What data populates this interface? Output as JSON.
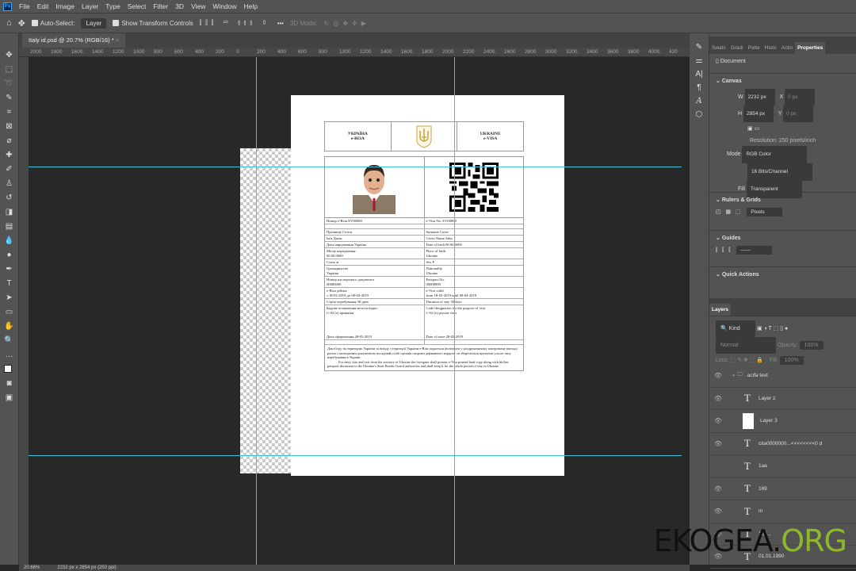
{
  "app": {
    "logo": "Ps",
    "menu": [
      "File",
      "Edit",
      "Image",
      "Layer",
      "Type",
      "Select",
      "Filter",
      "3D",
      "View",
      "Window",
      "Help"
    ]
  },
  "options": {
    "auto_select_label": "Auto-Select:",
    "auto_select_value": "Layer",
    "show_transform_label": "Show Transform Controls",
    "more": "•••",
    "mode_3d": "3D Mode:"
  },
  "document_tab": {
    "title": "Italy id.psd @ 20.7% (RGB/16) *",
    "close": "×"
  },
  "ruler": {
    "labels": [
      "2000",
      "1800",
      "1600",
      "1400",
      "1200",
      "1000",
      "800",
      "600",
      "400",
      "200",
      "0",
      "200",
      "400",
      "600",
      "800",
      "1000",
      "1200",
      "1400",
      "1600",
      "1800",
      "2000",
      "2200",
      "2400",
      "2600",
      "2800",
      "3000",
      "3200",
      "3400",
      "3600",
      "3800",
      "4000",
      "420"
    ]
  },
  "visa": {
    "header": {
      "left_title": "УКРАЇНА",
      "left_sub": "e-ВІЗА",
      "right_title": "UKRAINE",
      "right_sub": "e-VISA"
    },
    "rows": [
      [
        "Номер e-Візи                    EV00000",
        "e-Visa No.                         EV00000"
      ],
      [
        "",
        ""
      ],
      [
        "Прізвище Сотов",
        "Surname Cotov"
      ],
      [
        "Ім'я Джон",
        "Given Name John"
      ],
      [
        "Дата народження      Україна",
        "Date of birth 00.00.0000"
      ],
      [
        "Місце народження\n00.00.0000",
        "Place of birth\nUkraine"
      ],
      [
        "Стать ж",
        "Sex F"
      ],
      [
        "Громадянство\nУкраїна",
        "Nationality\nUkraine"
      ],
      [
        "Номер паспортного документа\n00000000",
        "Passport No.\n00000000"
      ],
      [
        "e-Віза дійсна\nз 18-02-2019 до 08-04-2019",
        "e-Visa valid\nfrom 18-02-2019 until 08-04-2019"
      ],
      [
        "Строк перебування 30 днів",
        "Duration of stay 30 days"
      ],
      [
        "Кодове позначення мети поїздки\nC-02 (е) приватна\n\n\n\n\nДата оформлення 28-02-2019",
        "Code designation for the purpose of visit\nC-02 (e) private visit\n\n\n\n\nDate of issue 28-02-2019"
      ],
      [
        "",
        ""
      ]
    ],
    "footer_ua": "Для в'їзду на територію України та виїзду з території України e-Віза подається іноземцем у роздрукованому паперовому вигляді разом з паспортним документом посадовій особі органів охорони державного кордону та зберігається протягом усього часу перебування в Україні.",
    "footer_en": "For entry into and exit from the territory of Ukraine the foreigner shall present e-Visa printed hard copy along with his/her passport document to the Ukraine's State Border Guard authorities and shall keep it for the whole period of stay in Ukraine."
  },
  "panels": {
    "tabs": [
      "Swatc",
      "Gradi",
      "Patte",
      "Histo",
      "Actio",
      "Properties"
    ],
    "doc_label": "Document",
    "canvas": {
      "title": "Canvas",
      "w_label": "W",
      "w": "2232 px",
      "h_label": "H",
      "h": "2854 px",
      "x_label": "X",
      "x": "0 px",
      "y_label": "Y",
      "y": "0 px",
      "resolution": "Resolution: 250 pixels/inch",
      "mode_label": "Mode",
      "mode": "RGB Color",
      "depth": "16 Bits/Channel",
      "fill_label": "Fill",
      "fill": "Transparent"
    },
    "rulers": {
      "title": "Rulers & Grids",
      "unit": "Pixels"
    },
    "guides": {
      "title": "Guides"
    },
    "quick": {
      "title": "Quick Actions"
    }
  },
  "layers": {
    "tab": "Layers",
    "kind": "Kind",
    "blend": "Normal",
    "opacity_label": "Opacity:",
    "opacity": "100%",
    "lock_label": "Lock:",
    "fill_label": "Fill:",
    "fill": "100%",
    "items": [
      {
        "name": "acifa text",
        "type": "group"
      },
      {
        "name": "Layer 2",
        "type": "text"
      },
      {
        "name": "Layer 3",
        "type": "pixel"
      },
      {
        "name": "cita0000000...<<<<<<<<0 d",
        "type": "text"
      },
      {
        "name": "1aa",
        "type": "text"
      },
      {
        "name": "169",
        "type": "text"
      },
      {
        "name": "m",
        "type": "text"
      },
      {
        "name": "125...",
        "type": "text"
      },
      {
        "name": "01.01.1990",
        "type": "text"
      }
    ]
  },
  "status": {
    "zoom": "20.66%",
    "size": "2232 px x 2854 px (250 ppi)"
  },
  "watermark": {
    "a": "EKOGEA.",
    "b": "ORG"
  }
}
